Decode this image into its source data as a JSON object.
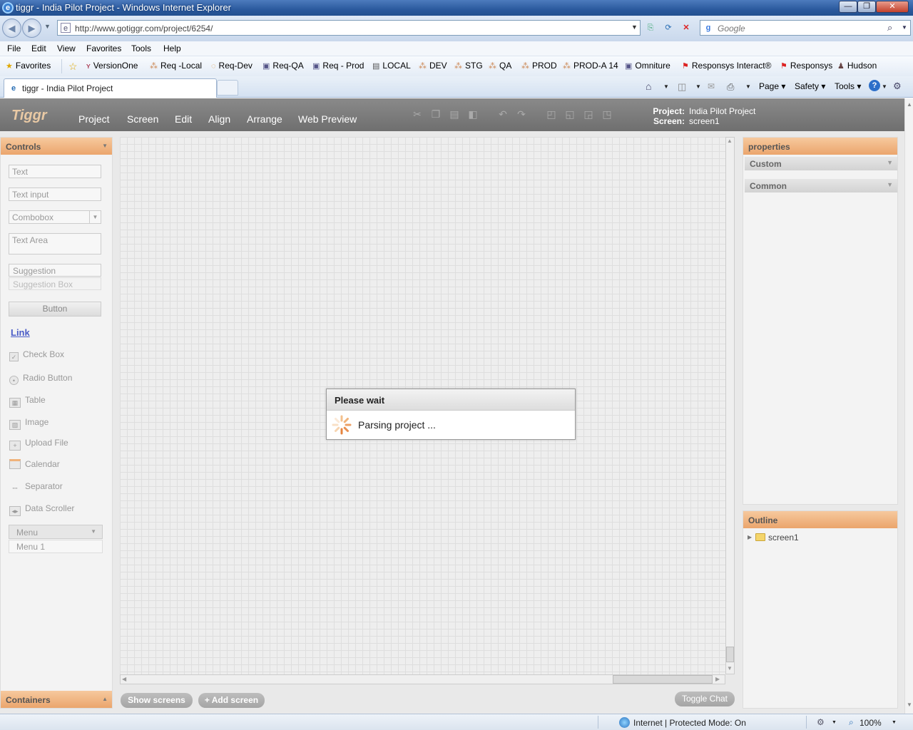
{
  "window": {
    "title": "tiggr - India Pilot Project - Windows Internet Explorer",
    "min_label": "—",
    "max_label": "❐",
    "close_label": "✕"
  },
  "address": {
    "url": "http://www.gotiggr.com/project/6254/",
    "search_placeholder": "Google"
  },
  "menu": [
    "File",
    "Edit",
    "View",
    "Favorites",
    "Tools",
    "Help"
  ],
  "favorites": {
    "label": "Favorites",
    "items": [
      "VersionOne",
      "Req -Local",
      "Req-Dev",
      "Req-QA",
      "Req - Prod",
      "LOCAL",
      "DEV",
      "STG",
      "QA",
      "PROD",
      "PROD-A 14",
      "Omniture",
      "Responsys Interact®",
      "Responsys",
      "Hudson"
    ]
  },
  "tab": {
    "title": "tiggr - India Pilot Project"
  },
  "commandbar": {
    "page": "Page",
    "safety": "Safety",
    "tools": "Tools"
  },
  "app": {
    "logo": "Tiggr",
    "menu": [
      "Project",
      "Screen",
      "Edit",
      "Align",
      "Arrange",
      "Web Preview"
    ],
    "project_label": "Project:",
    "project_value": "India Pilot Project",
    "screen_label": "Screen:",
    "screen_value": "screen1"
  },
  "controls": {
    "header": "Controls",
    "text": "Text",
    "text_input": "Text input",
    "combobox": "Combobox",
    "text_area": "Text Area",
    "suggestion": "Suggestion",
    "suggestion_box": "Suggestion Box",
    "button": "Button",
    "link": "Link",
    "check_box": "Check Box",
    "radio_button": "Radio Button",
    "table": "Table",
    "image": "Image",
    "upload_file": "Upload File",
    "calendar": "Calendar",
    "separator": "Separator",
    "data_scroller": "Data Scroller",
    "menu": "Menu",
    "menu_item": "Menu 1",
    "containers": "Containers"
  },
  "dialog": {
    "title": "Please wait",
    "message": "Parsing project ..."
  },
  "properties": {
    "header": "properties",
    "custom": "Custom",
    "common": "Common"
  },
  "outline": {
    "header": "Outline",
    "root": "screen1"
  },
  "bottom": {
    "show_screens": "Show screens",
    "add_screen": "+ Add screen",
    "toggle_chat": "Toggle Chat"
  },
  "status": {
    "zone": "Internet | Protected Mode: On",
    "zoom": "100%"
  }
}
